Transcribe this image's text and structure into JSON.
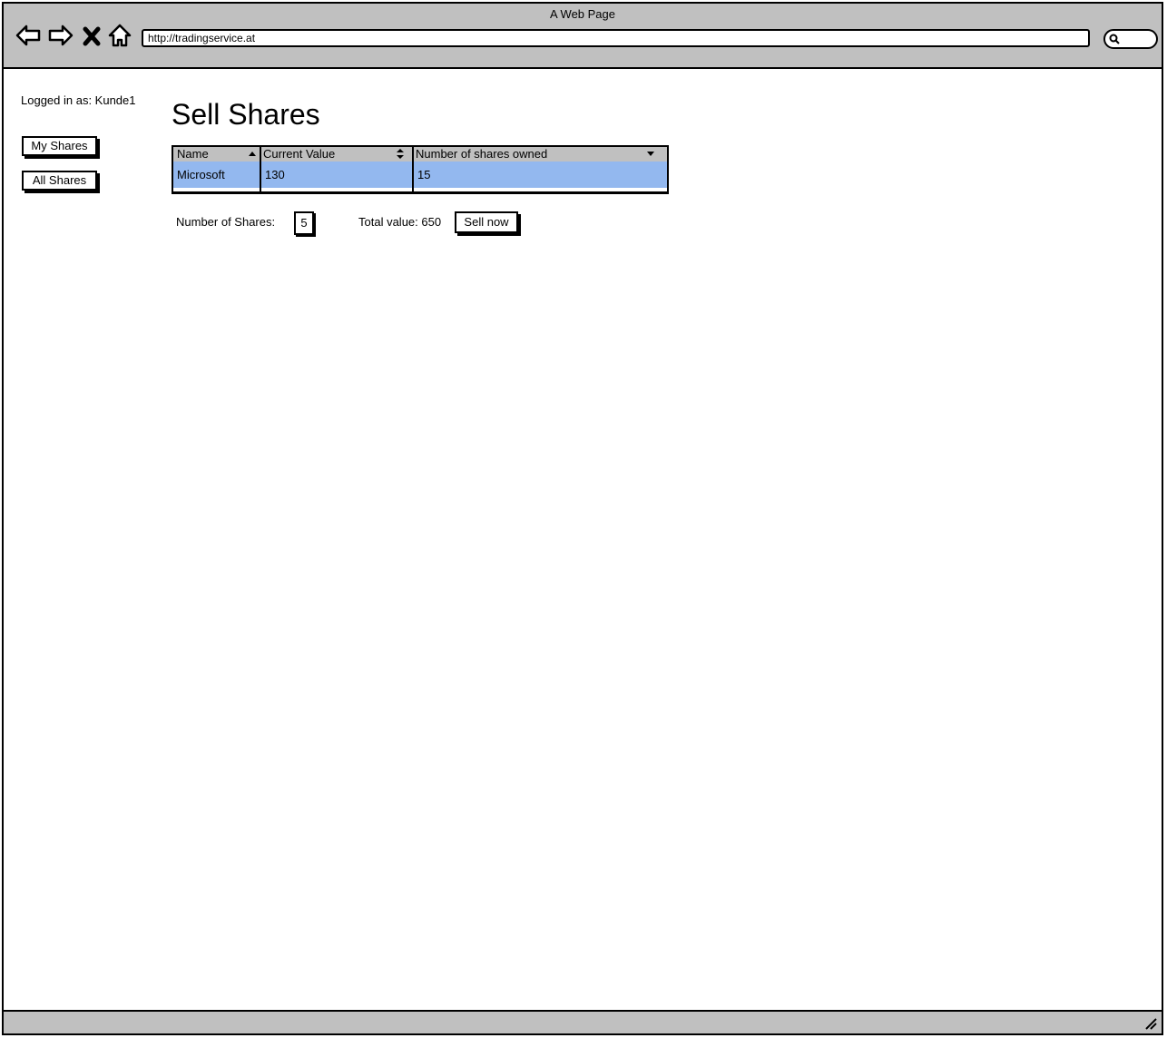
{
  "browser": {
    "window_title": "A Web Page",
    "url": "http://tradingservice.at"
  },
  "sidebar": {
    "logged_in": "Logged in as: Kunde1",
    "buttons": [
      "My Shares",
      "All Shares"
    ]
  },
  "main": {
    "title": "Sell Shares",
    "table": {
      "columns": [
        "Name",
        "Current Value",
        "Number of shares owned"
      ],
      "rows": [
        [
          "Microsoft",
          "130",
          "15"
        ]
      ]
    },
    "form": {
      "shares_label": "Number of Shares:",
      "shares_value": "5",
      "total_label": "Total value: 650",
      "sell_button": "Sell now"
    }
  },
  "icons": {
    "back": "back-arrow-icon",
    "forward": "forward-arrow-icon",
    "stop": "close-icon",
    "home": "home-icon",
    "search": "search-icon",
    "grip": "resize-grip-icon"
  },
  "colors": {
    "chrome": "#c0c0c0",
    "selected_row": "#93b8ef"
  }
}
